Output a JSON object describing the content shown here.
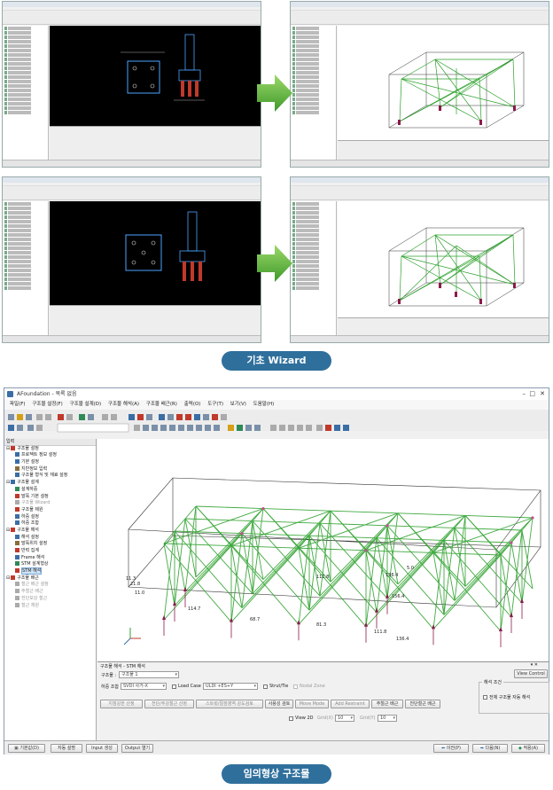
{
  "section1_label": "기초 Wizard",
  "section2_label": "임의형상 구조물",
  "main_window": {
    "title": "AFoundation - 목록 없음",
    "menu": [
      "파일(F)",
      "구조물 설정(F)",
      "구조물 설계(D)",
      "구조물 해석(A)",
      "구조물 배근(R)",
      "출력(O)",
      "도구(T)",
      "보기(V)",
      "도움말(H)"
    ],
    "tree_header": "입력",
    "tree": [
      {
        "label": "구조물 설정",
        "level": 0,
        "color": "#c0392b",
        "enabled": true
      },
      {
        "label": "프로젝트 정보 설정",
        "level": 1,
        "color": "#3a6ea5",
        "enabled": true
      },
      {
        "label": "기본 설정",
        "level": 1,
        "color": "#3a6ea5",
        "enabled": true
      },
      {
        "label": "지반정보 입력",
        "level": 1,
        "color": "#8a6d3b",
        "enabled": true
      },
      {
        "label": "구조물 형식 및 재료 설정",
        "level": 1,
        "color": "#3a6ea5",
        "enabled": true
      },
      {
        "label": "구조물 설계",
        "level": 0,
        "color": "#3a6ea5",
        "enabled": true
      },
      {
        "label": "설계하중",
        "level": 1,
        "color": "#2e8b57",
        "enabled": true
      },
      {
        "label": "말뚝 기본 설정",
        "level": 1,
        "color": "#c0392b",
        "enabled": true
      },
      {
        "label": "구조물 Wizard",
        "level": 1,
        "color": "#aaaaaa",
        "enabled": false
      },
      {
        "label": "구조물 제원",
        "level": 1,
        "color": "#c0392b",
        "enabled": true
      },
      {
        "label": "하중 설정",
        "level": 1,
        "color": "#3a6ea5",
        "enabled": true
      },
      {
        "label": "하중 조합",
        "level": 1,
        "color": "#3a6ea5",
        "enabled": true
      },
      {
        "label": "구조물 해석",
        "level": 0,
        "color": "#c0392b",
        "enabled": true
      },
      {
        "label": "해석 설정",
        "level": 1,
        "color": "#3a6ea5",
        "enabled": true
      },
      {
        "label": "말뚝위치 설정",
        "level": 1,
        "color": "#8a6d3b",
        "enabled": true
      },
      {
        "label": "반력 집계",
        "level": 1,
        "color": "#c0392b",
        "enabled": true
      },
      {
        "label": "Frame 해석",
        "level": 1,
        "color": "#3a6ea5",
        "enabled": true
      },
      {
        "label": "STM 설계형상",
        "level": 1,
        "color": "#2e8b57",
        "enabled": true
      },
      {
        "label": "STM 해석",
        "level": 1,
        "color": "#c0392b",
        "enabled": true
      },
      {
        "label": "구조물 배근",
        "level": 0,
        "color": "#c0392b",
        "enabled": true
      },
      {
        "label": "철근 배근 설정",
        "level": 1,
        "color": "#aaaaaa",
        "enabled": false
      },
      {
        "label": "주철근 배근",
        "level": 1,
        "color": "#aaaaaa",
        "enabled": false
      },
      {
        "label": "전단보강 철근",
        "level": 1,
        "color": "#aaaaaa",
        "enabled": false
      },
      {
        "label": "철근 재원",
        "level": 1,
        "color": "#aaaaaa",
        "enabled": false
      }
    ],
    "panel": {
      "title": "구조물 해석 - STM 해석",
      "structure_label": "구조물 :",
      "structure_value": "구조물 1",
      "view_control": "View Control",
      "load_combo_label": "하중 조합",
      "load_combo_value": "SVDI 사거-X",
      "load_case_label": "Load Case",
      "load_case_value": "ULDI +ES+Y",
      "strut_tie_label": "Strut/Tie",
      "nodal_zone_label": "Nodal Zone",
      "analysis_condition_title": "해석 조건",
      "analysis_condition_check": "전체 구조물 자동 해석",
      "buttons_row": [
        "지점강한 산정",
        "전단/주강철근 산정",
        "스트럿/절점영역 강도검토",
        "사용성 검토",
        "Move Mode",
        "Add Restraint",
        "주철근 배근",
        "전단철근 배근"
      ],
      "view2d_label": "View 2D",
      "grid_x_label": "Grid(X)",
      "grid_x_value": "10",
      "grid_y_label": "Grid(Y)",
      "grid_y_value": "10"
    },
    "footer_buttons": [
      "기본값(D)",
      "자동 설명",
      "Input 생성",
      "Output 열기"
    ],
    "nav_buttons": [
      "이전(P)",
      "다음(N)",
      "적용(A)"
    ]
  },
  "chart_labels": [
    "1.0",
    "11.0",
    "114.7",
    "68.7",
    "81.3",
    "111.8",
    "136.4",
    "156.4",
    "136.4",
    "111.8",
    "21.8",
    "11.3",
    "1.3",
    "5.0"
  ],
  "colors": {
    "pill_bg": "#2f6f9c",
    "truss_green": "#2ca02c",
    "arrow_green": "#6abf3a"
  }
}
